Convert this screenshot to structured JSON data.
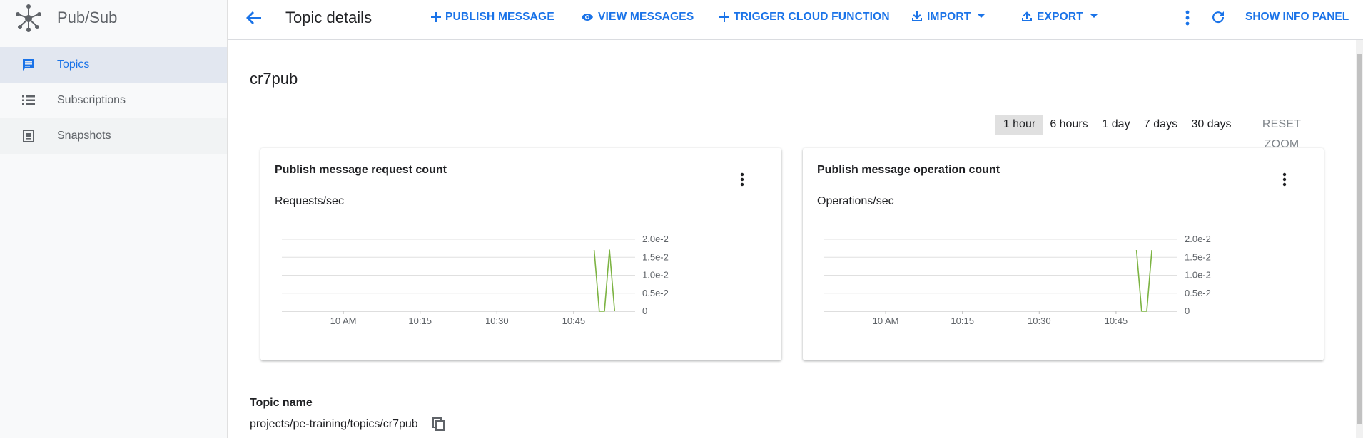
{
  "app": {
    "title": "Pub/Sub"
  },
  "sidebar": {
    "items": [
      {
        "label": "Topics",
        "icon": "topics-icon",
        "active": true
      },
      {
        "label": "Subscriptions",
        "icon": "list-icon",
        "active": false
      },
      {
        "label": "Snapshots",
        "icon": "snapshot-icon",
        "active": false
      }
    ]
  },
  "header": {
    "title": "Topic details",
    "actions": {
      "publish": "PUBLISH MESSAGE",
      "view": "VIEW MESSAGES",
      "trigger": "TRIGGER CLOUD FUNCTION",
      "import": "IMPORT",
      "export": "EXPORT",
      "info": "SHOW INFO PANEL"
    }
  },
  "topic": {
    "id": "cr7pub",
    "name_label": "Topic name",
    "name_value": "projects/pe-training/topics/cr7pub"
  },
  "time_range": {
    "options": [
      "1 hour",
      "6 hours",
      "1 day",
      "7 days",
      "30 days"
    ],
    "selected": "1 hour",
    "reset": "RESET ZOOM"
  },
  "colors": {
    "accent": "#1a73e8",
    "series": "#7cb342",
    "active_nav_bg": "#e2e7f0"
  },
  "chart_data": [
    {
      "type": "line",
      "title": "Publish message request count",
      "ylabel": "Requests/sec",
      "x_ticks": [
        "10 AM",
        "10:15",
        "10:30",
        "10:45"
      ],
      "y_ticks": [
        "2.0e-2",
        "1.5e-2",
        "1.0e-2",
        "0.5e-2",
        "0"
      ],
      "ylim": [
        0,
        0.02
      ],
      "x": [
        "10:49",
        "10:50",
        "10:51",
        "10:52",
        "10:53"
      ],
      "series": [
        {
          "values": [
            0.017,
            0,
            0,
            0.017,
            0
          ]
        }
      ]
    },
    {
      "type": "line",
      "title": "Publish message operation count",
      "ylabel": "Operations/sec",
      "x_ticks": [
        "10 AM",
        "10:15",
        "10:30",
        "10:45"
      ],
      "y_ticks": [
        "2.0e-2",
        "1.5e-2",
        "1.0e-2",
        "0.5e-2",
        "0"
      ],
      "ylim": [
        0,
        0.02
      ],
      "x": [
        "10:49",
        "10:50",
        "10:51",
        "10:52"
      ],
      "series": [
        {
          "values": [
            0.017,
            0,
            0,
            0.017
          ]
        }
      ]
    }
  ]
}
